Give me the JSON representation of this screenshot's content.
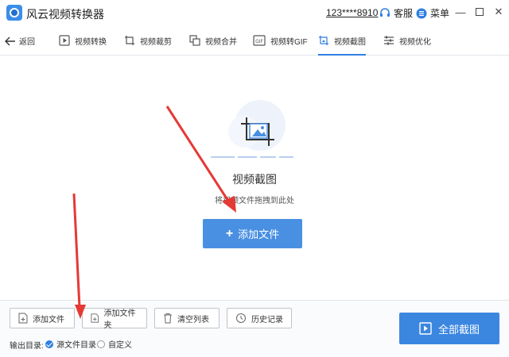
{
  "app": {
    "title": "风云视频转换器",
    "account": "123****8910"
  },
  "titlebar": {
    "service_label": "客服",
    "menu_label": "菜单"
  },
  "nav": {
    "back_label": "返回",
    "tabs": [
      {
        "label": "视频转换",
        "icon": "play-icon"
      },
      {
        "label": "视频裁剪",
        "icon": "crop-icon"
      },
      {
        "label": "视频合并",
        "icon": "merge-icon"
      },
      {
        "label": "视频转GIF",
        "icon": "gif-icon"
      },
      {
        "label": "视频截图",
        "icon": "screenshot-icon",
        "active": true
      },
      {
        "label": "视频优化",
        "icon": "sliders-icon"
      }
    ]
  },
  "main": {
    "title": "视频截图",
    "hint": "将视频文件拖拽到此处",
    "add_file_label": "添加文件"
  },
  "bottom": {
    "buttons": [
      {
        "label": "添加文件"
      },
      {
        "label": "添加文件夹"
      },
      {
        "label": "清空列表"
      },
      {
        "label": "历史记录"
      }
    ],
    "output_label": "输出目录:",
    "options": [
      {
        "label": "源文件目录",
        "selected": true
      },
      {
        "label": "自定义",
        "selected": false
      }
    ],
    "convert_all_label": "全部截图"
  },
  "colors": {
    "accent": "#3b87e0",
    "annotation": "#e53935"
  }
}
